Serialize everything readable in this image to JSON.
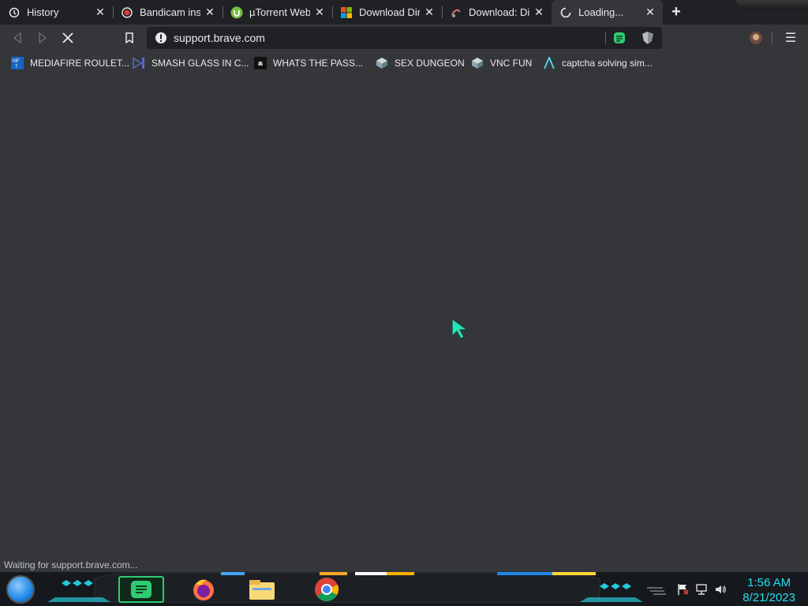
{
  "tabs": [
    {
      "label": "History",
      "icon": "history-icon",
      "close": "✕"
    },
    {
      "label": "Bandicam instal",
      "icon": "bandicam-icon",
      "close": "✕"
    },
    {
      "label": "µTorrent Web",
      "icon": "utorrent-icon",
      "close": "✕"
    },
    {
      "label": "Download Direc",
      "icon": "microsoft-icon",
      "close": "✕"
    },
    {
      "label": "Download: Dire",
      "icon": "site-favicon-icon",
      "close": "✕"
    },
    {
      "label": "Loading...",
      "icon": "loading-spinner-icon",
      "close": "✕",
      "active": true
    }
  ],
  "new_tab_label": "+",
  "toolbar": {
    "url": "support.brave.com",
    "menu_glyph": "☰"
  },
  "bookmarks": [
    {
      "label": "MEDIAFIRE ROULET...",
      "icon": "mediafire-icon"
    },
    {
      "label": "SMASH GLASS IN C...",
      "icon": "visual-studio-icon"
    },
    {
      "label": "WHATS THE PASS...",
      "icon": "dark-box-icon"
    },
    {
      "label": "SEX DUNGEON",
      "icon": "steam-icon"
    },
    {
      "label": "VNC FUN",
      "icon": "steam-icon"
    },
    {
      "label": "captcha solving sim...",
      "icon": "arrow-a-icon"
    }
  ],
  "status_text": "Waiting for support.brave.com...",
  "taskbar": {
    "time": "1:56 AM",
    "date": "8/21/2023"
  },
  "colors": {
    "content_bg": "#35363a",
    "tabstrip_bg": "#202124",
    "clock": "#22e0f0",
    "accent_green": "#2ecc71"
  }
}
